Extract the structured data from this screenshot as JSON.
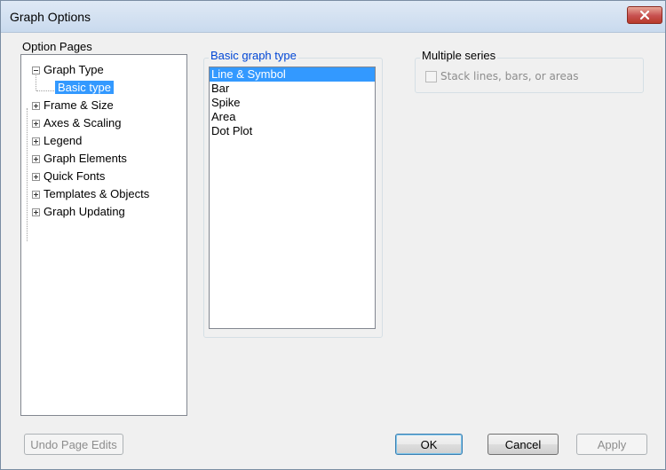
{
  "window": {
    "title": "Graph Options"
  },
  "option_pages": {
    "label": "Option Pages",
    "items": [
      {
        "label": "Graph Type",
        "expanded": true,
        "children": [
          {
            "label": "Basic type",
            "selected": true
          }
        ]
      },
      {
        "label": "Frame & Size",
        "expanded": false
      },
      {
        "label": "Axes & Scaling",
        "expanded": false
      },
      {
        "label": "Legend",
        "expanded": false
      },
      {
        "label": "Graph Elements",
        "expanded": false
      },
      {
        "label": "Quick Fonts",
        "expanded": false
      },
      {
        "label": "Templates & Objects",
        "expanded": false
      },
      {
        "label": "Graph Updating",
        "expanded": false
      }
    ]
  },
  "basic_graph_type": {
    "label": "Basic graph type",
    "options": [
      "Line & Symbol",
      "Bar",
      "Spike",
      "Area",
      "Dot Plot"
    ],
    "selected": "Line & Symbol"
  },
  "multiple_series": {
    "label": "Multiple series",
    "checkbox_label": "Stack lines, bars, or areas",
    "checked": false,
    "enabled": false
  },
  "buttons": {
    "undo": "Undo Page Edits",
    "ok": "OK",
    "cancel": "Cancel",
    "apply": "Apply"
  }
}
